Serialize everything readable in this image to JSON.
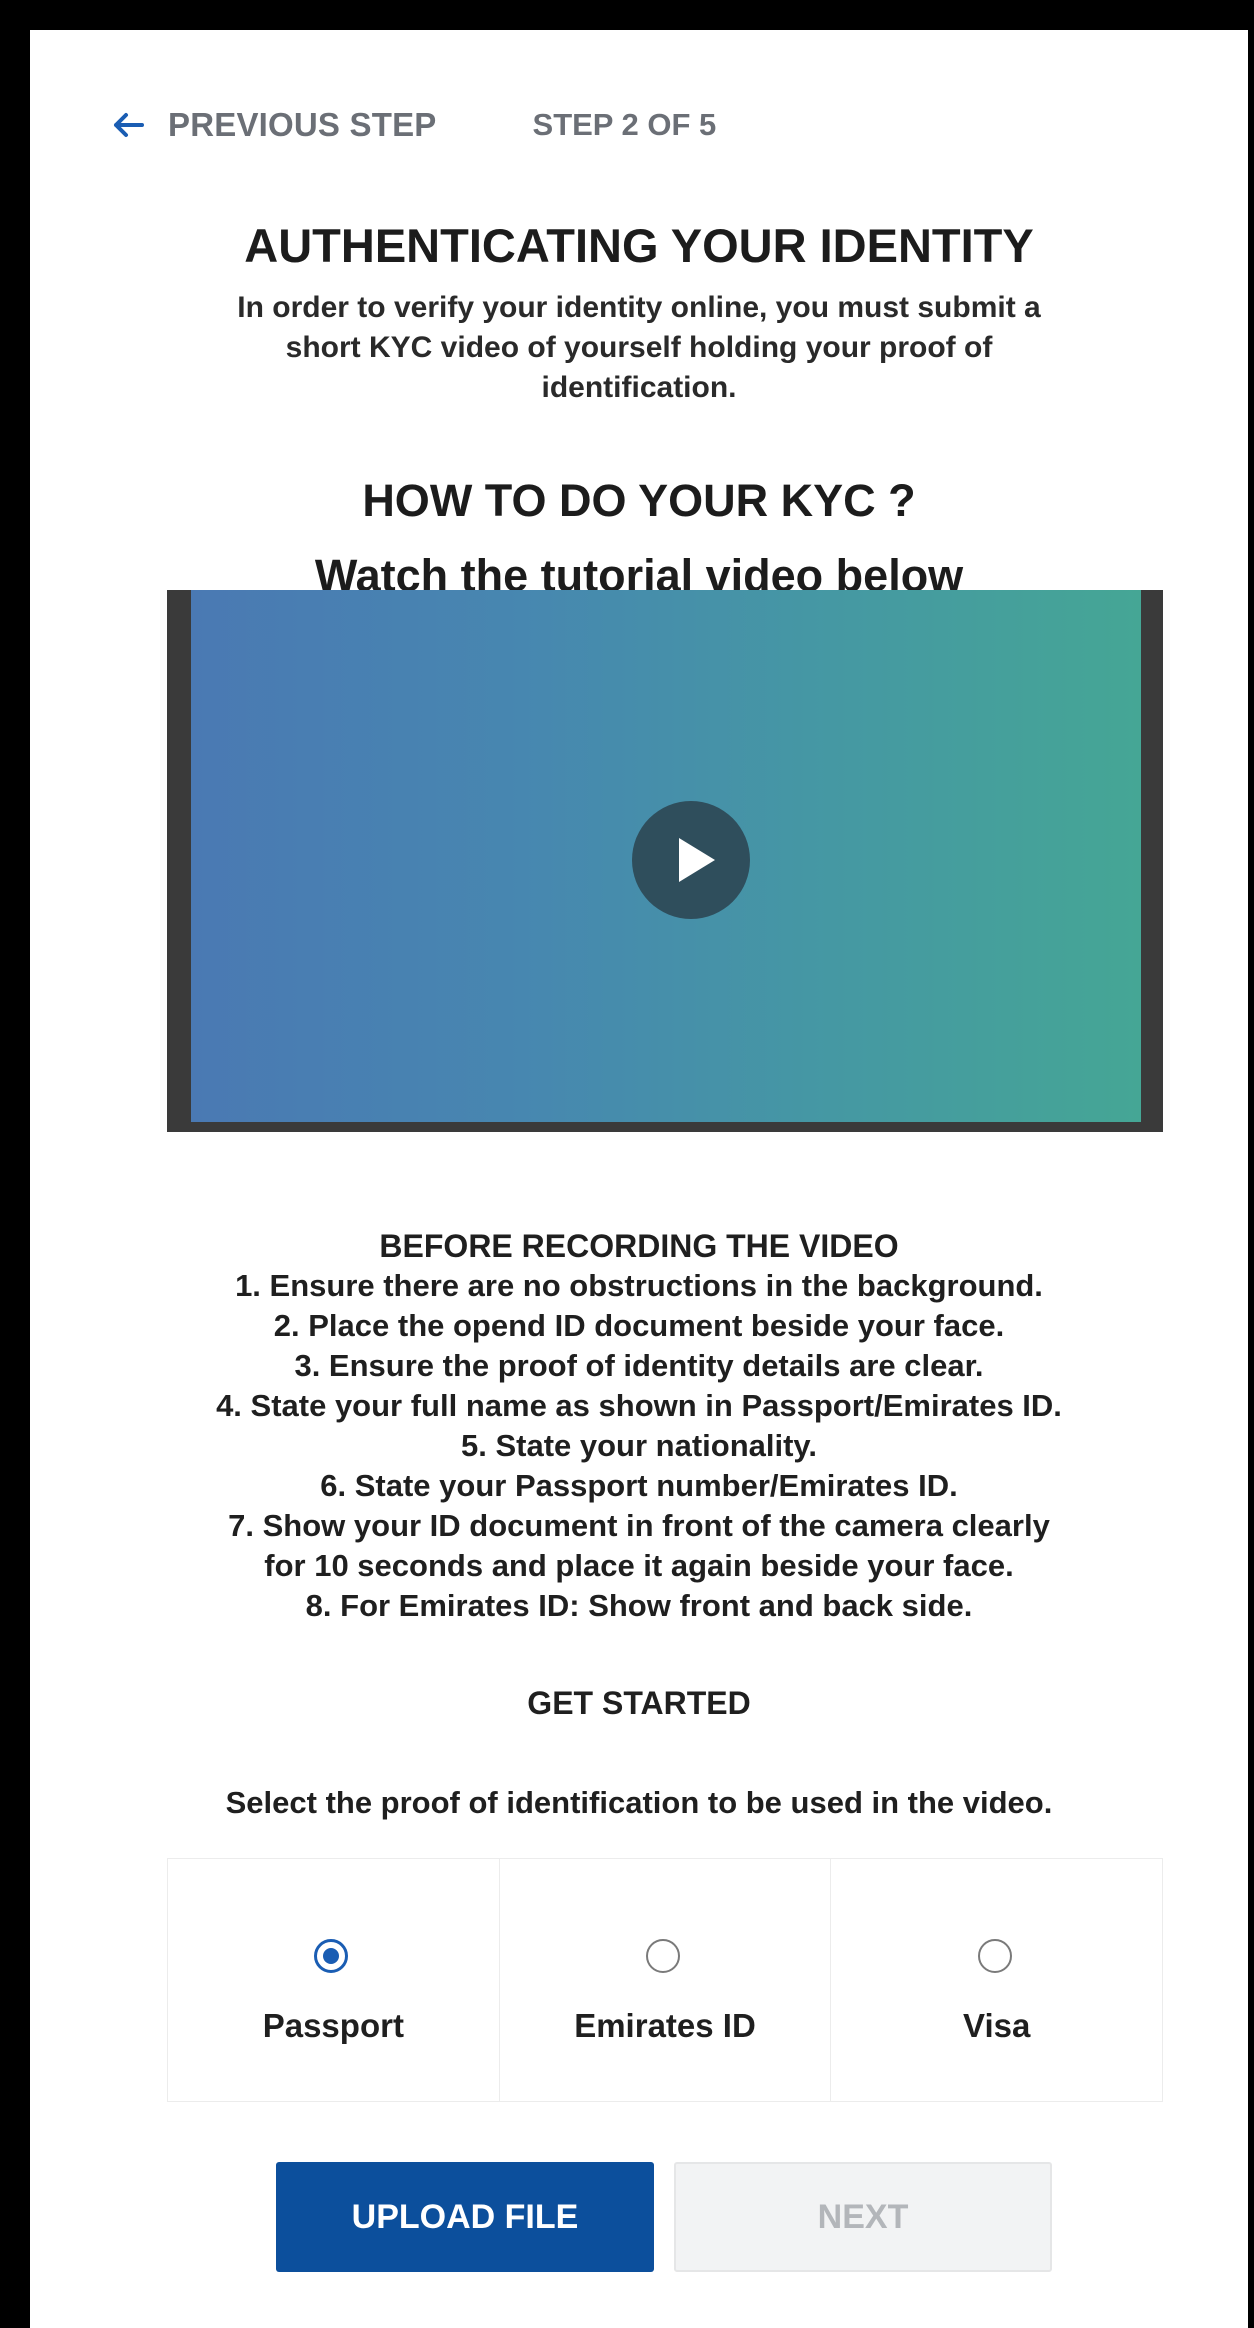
{
  "nav": {
    "back_label": "PREVIOUS STEP",
    "step_indicator": "STEP 2 OF 5"
  },
  "header": {
    "title": "AUTHENTICATING YOUR IDENTITY",
    "intro_lines": [
      "In order to verify your identity online, you must submit a",
      "short KYC video of yourself holding your proof of",
      "identification."
    ]
  },
  "tutorial": {
    "heading": "HOW TO DO YOUR KYC ?",
    "subheading": "Watch the tutorial video below",
    "play_icon": "play-icon"
  },
  "instructions": {
    "heading": "BEFORE RECORDING THE VIDEO",
    "lines": [
      "1. Ensure there are no obstructions in the background.",
      "2. Place the opend ID document beside your face.",
      "3. Ensure the proof of identity details are clear.",
      "4. State your full name as shown in Passport/Emirates ID.",
      "5. State your nationality.",
      "6. State your Passport number/Emirates ID.",
      "7. Show your ID document in front of the camera clearly",
      "for 10 seconds and place it again beside your face.",
      "8. For Emirates ID: Show front and back side."
    ]
  },
  "get_started": {
    "heading": "GET STARTED",
    "prompt": "Select the proof of identification to be used in the video.",
    "options": [
      {
        "label": "Passport",
        "selected": true
      },
      {
        "label": "Emirates ID",
        "selected": false
      },
      {
        "label": "Visa",
        "selected": false
      }
    ]
  },
  "actions": {
    "upload_label": "UPLOAD FILE",
    "next_label": "NEXT"
  },
  "colors": {
    "primary": "#0c4f9c",
    "radio_selected": "#1a5db3",
    "muted_text": "#6b6f76"
  }
}
